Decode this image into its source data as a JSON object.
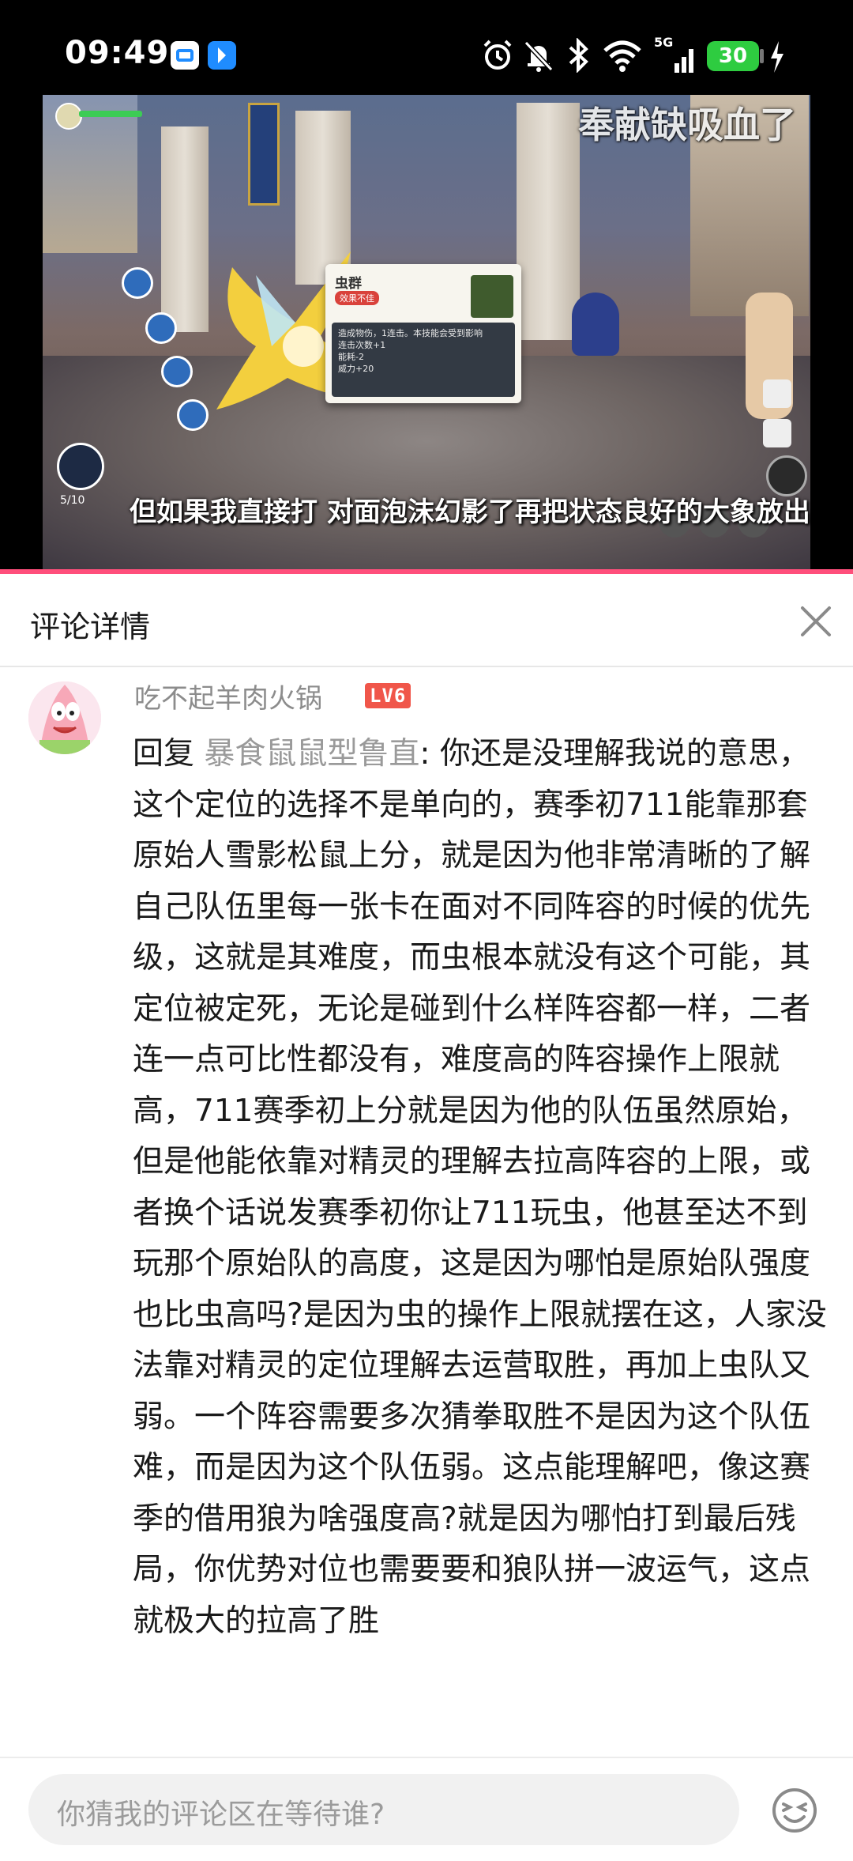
{
  "status_bar": {
    "time": "09:49",
    "battery": "30",
    "network": "5G",
    "icons": [
      "alarm-icon",
      "mute-bell-icon",
      "bluetooth-icon",
      "wifi-icon",
      "signal-icon",
      "charging-icon"
    ],
    "battery_color": "#2ecc40"
  },
  "video": {
    "danmaku": "奉献缺吸血了",
    "subtitle": "但如果我直接打 对面泡沫幻影了再把状态良好的大象放出来",
    "skill_card": {
      "title": "虫群",
      "tag": "效果不佳",
      "lines": [
        "造成物伤，1连击。本技能会受到影响",
        "连击次数+1",
        "能耗-2",
        "威力+20"
      ]
    },
    "hud_counter": "5/10",
    "progress_color": "#ff4f7b"
  },
  "panel": {
    "title": "评论详情",
    "close_icon": "close-icon"
  },
  "comment": {
    "username": "吃不起羊肉火锅",
    "level": "LV6",
    "reply_prefix": "回复 ",
    "reply_to": "暴食鼠鼠型鲁直",
    "text": ": 你还是没理解我说的意思，这个定位的选择不是单向的，赛季初711能靠那套原始人雪影松鼠上分，就是因为他非常清晰的了解自己队伍里每一张卡在面对不同阵容的时候的优先级，这就是其难度，而虫根本就没有这个可能，其定位被定死，无论是碰到什么样阵容都一样，二者连一点可比性都没有，难度高的阵容操作上限就高，711赛季初上分就是因为他的队伍虽然原始，但是他能依靠对精灵的理解去拉高阵容的上限，或者换个话说发赛季初你让711玩虫，他甚至达不到玩那个原始队的高度，这是因为哪怕是原始队强度也比虫高吗?是因为虫的操作上限就摆在这，人家没法靠对精灵的定位理解去运营取胜，再加上虫队又弱。一个阵容需要多次猜拳取胜不是因为这个队伍难，而是因为这个队伍弱。这点能理解吧，像这赛季的借用狼为啥强度高?就是因为哪怕打到最后残局，你优势对位也需要要和狼队拼一波运气，这点就极大的拉高了胜"
  },
  "composer": {
    "placeholder": "你猜我的评论区在等待谁?",
    "emoji_icon": "emoji-icon"
  }
}
